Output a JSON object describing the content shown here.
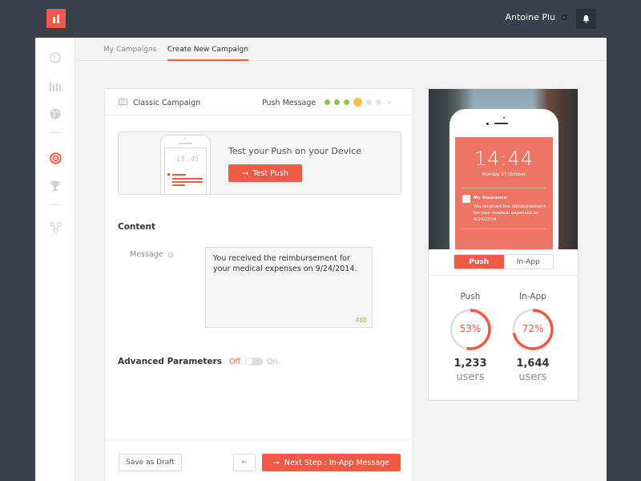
{
  "header": {
    "logo": "app-logo",
    "user_name": "Antoine Plu",
    "notifications_icon": "bell-icon"
  },
  "sidebar": {
    "items": [
      {
        "name": "dashboard",
        "icon": "gauge-icon",
        "active": false
      },
      {
        "name": "analytics",
        "icon": "bar-chart-icon",
        "active": false
      },
      {
        "name": "geo",
        "icon": "globe-icon",
        "active": false
      },
      {
        "name": "campaigns",
        "icon": "target-icon",
        "active": true
      },
      {
        "name": "achievements",
        "icon": "trophy-icon",
        "active": false
      },
      {
        "name": "integrations",
        "icon": "nodes-icon",
        "active": false
      }
    ]
  },
  "tabs": [
    {
      "label": "My Campaigns",
      "active": false
    },
    {
      "label": "Create New Campaign",
      "active": true
    }
  ],
  "campaign": {
    "type_label": "Classic Campaign",
    "step_label": "Push Message",
    "steps_total": 6,
    "steps_done": 3,
    "current_step": 4,
    "step_next_glyph": ">"
  },
  "test_push": {
    "title": "Test your Push on your Device",
    "button_label": "Test Push",
    "button_icon": "→",
    "mini_phone_time": "13 : 45"
  },
  "content": {
    "section_title": "Content",
    "message_label": "Message",
    "info_icon": "i",
    "message_value": "You received the reimbursement for your medical expenses on 9/24/2014.",
    "char_count": "480"
  },
  "advanced": {
    "label": "Advanced Parameters",
    "off_label": "Off",
    "on_label": "On",
    "enabled": false
  },
  "footer": {
    "save_draft_label": "Save as Draft",
    "back_icon": "←",
    "next_label": "Next Step : In-App Message",
    "next_icon": "→"
  },
  "preview": {
    "lock_time": "14:44",
    "lock_date": "Monday 27 October",
    "notif_title": "My Insurance",
    "notif_body": "You received the reimbursement for your medical expenses on 9/24/2014",
    "segments": [
      {
        "label": "Push",
        "active": true
      },
      {
        "label": "In-App",
        "active": false
      }
    ],
    "stats": [
      {
        "label": "Push",
        "percent": 53,
        "percent_text": "53%",
        "count": "1,233",
        "unit": "users"
      },
      {
        "label": "In-App",
        "percent": 72,
        "percent_text": "72%",
        "count": "1,644",
        "unit": "users"
      }
    ]
  },
  "colors": {
    "accent": "#f15a46",
    "header_bg": "#3a414c",
    "step_done": "#8cc152",
    "step_current": "#fcbd4a",
    "step_todo": "#e3e3e3"
  }
}
